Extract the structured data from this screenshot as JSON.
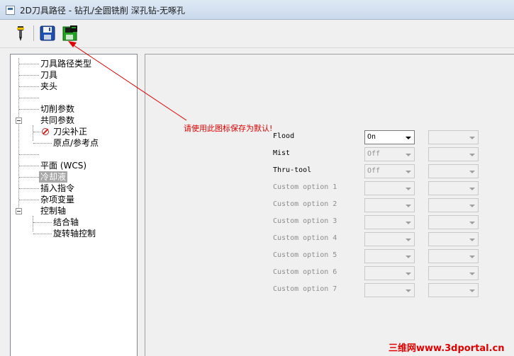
{
  "window": {
    "title": "2D刀具路径 - 钻孔/全圆铣削 深孔钻-无啄孔"
  },
  "toolbar": {
    "buttons": [
      {
        "icon": "tool-icon"
      },
      {
        "icon": "save-icon"
      },
      {
        "icon": "save-default-icon"
      }
    ]
  },
  "tree": {
    "items": [
      {
        "label": "刀具路径类型"
      },
      {
        "label": "刀具"
      },
      {
        "label": "夹头"
      },
      {
        "label": ""
      },
      {
        "label": "切削参数"
      },
      {
        "label": "共同参数"
      },
      {
        "label": "刀尖补正"
      },
      {
        "label": "原点/参考点"
      },
      {
        "label": ""
      },
      {
        "label": "平面 (WCS)"
      },
      {
        "label": "冷却液"
      },
      {
        "label": "插入指令"
      },
      {
        "label": "杂项变量"
      },
      {
        "label": "控制轴"
      },
      {
        "label": "结合轴"
      },
      {
        "label": "旋转轴控制"
      }
    ],
    "selected": "冷却液"
  },
  "hint": "请使用此图标保存为默认!",
  "coolant": {
    "rows": [
      {
        "label": "Flood",
        "value": "On",
        "value2": ""
      },
      {
        "label": "Mist",
        "value": "Off",
        "value2": ""
      },
      {
        "label": "Thru-tool",
        "value": "Off",
        "value2": ""
      },
      {
        "label": "Custom option 1",
        "value": "",
        "value2": ""
      },
      {
        "label": "Custom option 2",
        "value": "",
        "value2": ""
      },
      {
        "label": "Custom option 3",
        "value": "",
        "value2": ""
      },
      {
        "label": "Custom option 4",
        "value": "",
        "value2": ""
      },
      {
        "label": "Custom option 5",
        "value": "",
        "value2": ""
      },
      {
        "label": "Custom option 6",
        "value": "",
        "value2": ""
      },
      {
        "label": "Custom option 7",
        "value": "",
        "value2": ""
      }
    ]
  },
  "watermark": "三维网www.3dportal.cn",
  "colors": {
    "hint": "#e00000",
    "selection": "#a7a7a7",
    "accent": "#3a6ea5"
  }
}
